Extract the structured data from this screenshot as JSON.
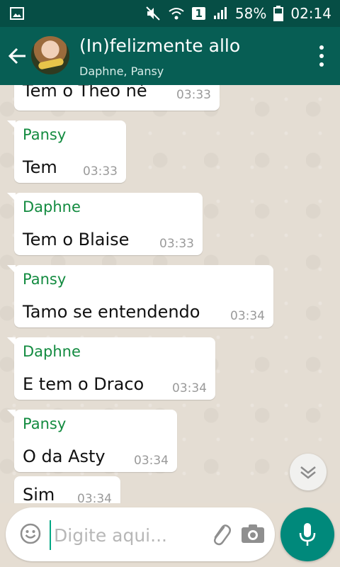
{
  "status_bar": {
    "battery": "58%",
    "time": "02:14",
    "sim": "1"
  },
  "header": {
    "title": "(In)felizmente allo",
    "subtitle": "Daphne, Pansy"
  },
  "messages": [
    {
      "sender": "",
      "text": "Tem o Theo né",
      "time": "03:33"
    },
    {
      "sender": "Pansy",
      "text": "Tem",
      "time": "03:33"
    },
    {
      "sender": "Daphne",
      "text": "Tem o Blaise",
      "time": "03:33"
    },
    {
      "sender": "Pansy",
      "text": "Tamo se entendendo",
      "time": "03:34"
    },
    {
      "sender": "Daphne",
      "text": "E tem o Draco",
      "time": "03:34"
    },
    {
      "sender": "Pansy",
      "text": "O da Asty",
      "time": "03:34"
    },
    {
      "sender": "",
      "text": "Sim",
      "time": "03:34"
    }
  ],
  "composer": {
    "placeholder": "Digite aqui..."
  },
  "colors": {
    "header": "#075e54",
    "sender_name": "#138b40",
    "accent": "#00897b"
  }
}
